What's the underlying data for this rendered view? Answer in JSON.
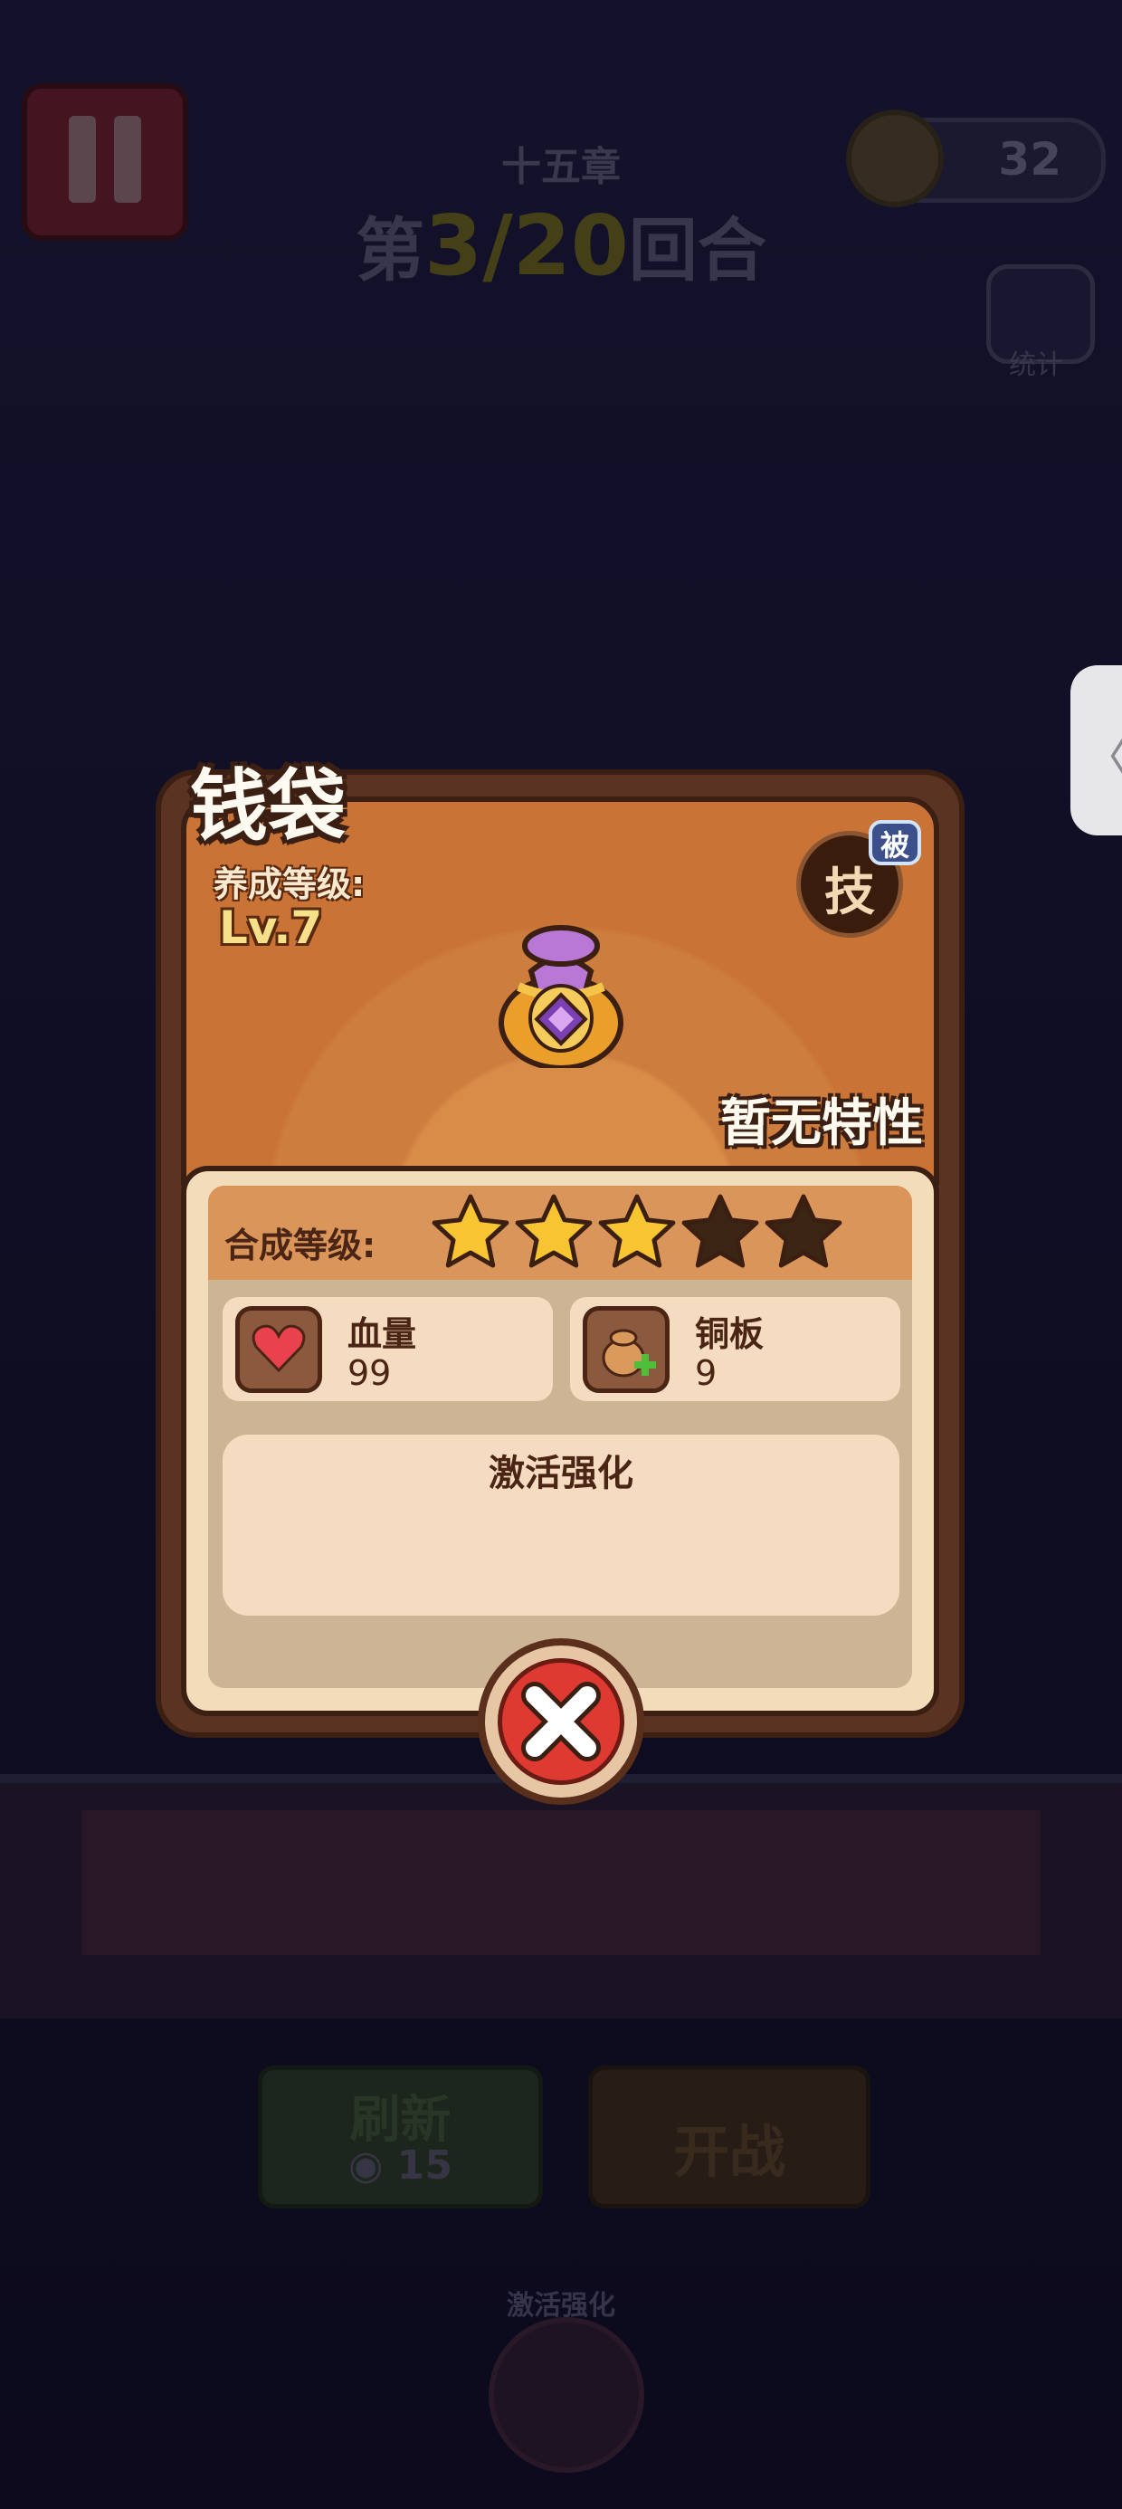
{
  "hud": {
    "chapter": "十五章",
    "round_prefix": "第",
    "round_current": "3",
    "round_total": "20",
    "round_suffix": "回合",
    "coins": "32",
    "stats_label": "统计"
  },
  "side_tab": {
    "icon": "chevron-left-icon",
    "glyph": "〈"
  },
  "popup": {
    "title": "钱袋",
    "level_label": "养成等级:",
    "level_value": "Lv.7",
    "skill_label": "技",
    "skill_badge": "被",
    "trait": "暂无特性",
    "merge_label": "合成等级:",
    "stars": {
      "filled": 3,
      "total": 5
    },
    "stats": [
      {
        "name": "血量",
        "value": "99",
        "icon": "heart-icon"
      },
      {
        "name": "铜板",
        "value": "9",
        "icon": "coin-bag-plus-icon"
      }
    ],
    "enhance_title": "激活强化",
    "close_icon": "close-icon"
  },
  "bottom": {
    "refresh_label": "刷新",
    "refresh_cost": "15",
    "battle_label": "开战",
    "enhance_label": "激活强化"
  },
  "colors": {
    "star_filled": "#f7c531",
    "star_empty": "#3b2614",
    "close_red": "#df3a32",
    "card_brown": "#5a3322"
  }
}
